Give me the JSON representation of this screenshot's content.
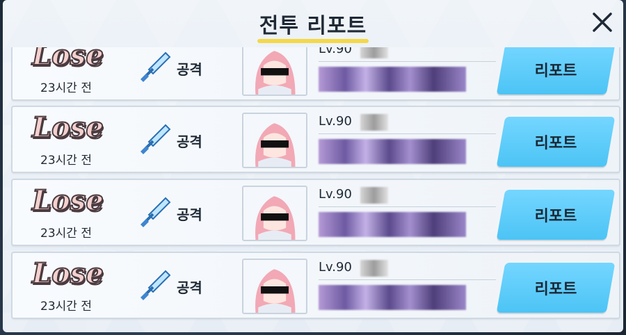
{
  "header": {
    "title": "전투 리포트",
    "close_icon": "close-icon",
    "accent_color": "#f3d84c"
  },
  "rows": [
    {
      "result": "Lose",
      "time": "23시간 전",
      "role": "공격",
      "level": "Lv.90",
      "report_button": "리포트"
    },
    {
      "result": "Lose",
      "time": "23시간 전",
      "role": "공격",
      "level": "Lv.90",
      "report_button": "리포트"
    },
    {
      "result": "Lose",
      "time": "23시간 전",
      "role": "공격",
      "level": "Lv.90",
      "report_button": "리포트"
    },
    {
      "result": "Lose",
      "time": "23시간 전",
      "role": "공격",
      "level": "Lv.90",
      "report_button": "리포트"
    }
  ],
  "colors": {
    "report_button": "#5ccbf9",
    "lose_fill": "#f3d1cf",
    "lose_outline": "#4b3b40"
  }
}
